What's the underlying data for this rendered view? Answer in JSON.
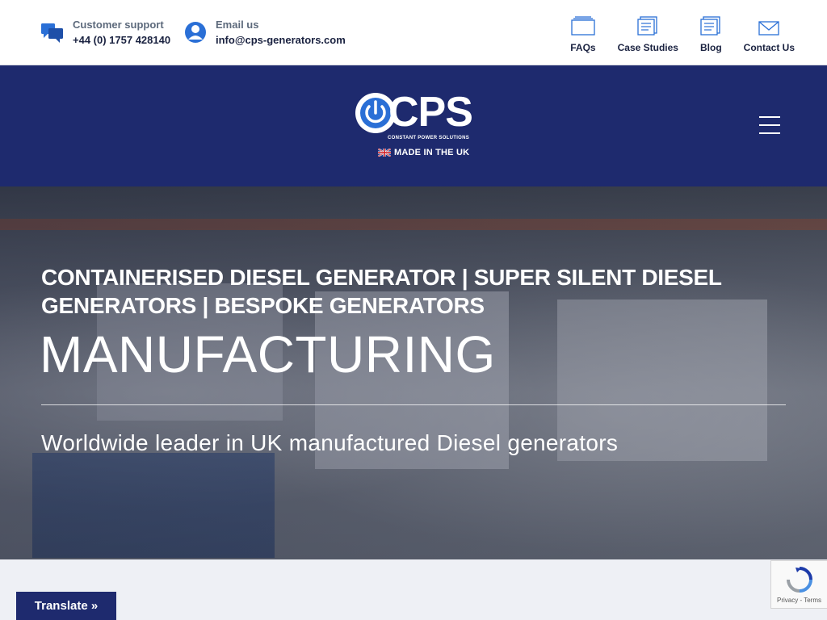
{
  "topbar": {
    "support": {
      "label": "Customer support",
      "value": "+44 (0) 1757 428140",
      "icon": "chat-bubbles-icon"
    },
    "email": {
      "label": "Email us",
      "value": "info@cps-generators.com",
      "icon": "user-icon"
    },
    "nav": [
      {
        "label": "FAQs",
        "icon": "folder-icon"
      },
      {
        "label": "Case Studies",
        "icon": "document-icon"
      },
      {
        "label": "Blog",
        "icon": "document-icon"
      },
      {
        "label": "Contact Us",
        "icon": "envelope-icon"
      }
    ]
  },
  "header": {
    "logo": {
      "letters": "CPS",
      "subtitle": "CONSTANT POWER SOLUTIONS",
      "made_in": "MADE IN THE UK"
    },
    "menu_icon": "hamburger-icon"
  },
  "hero": {
    "subtitle": "CONTAINERISED DIESEL GENERATOR | SUPER SILENT DIESEL GENERATORS | BESPOKE GENERATORS",
    "title": "MANUFACTURING",
    "tagline": "Worldwide leader in UK manufactured Diesel generators"
  },
  "widgets": {
    "translate_label": "Translate »",
    "recaptcha_text": "Privacy - Terms"
  },
  "colors": {
    "brand_navy": "#1e2a6e",
    "accent_blue": "#2a6fd6",
    "text_dark": "#1a2240"
  }
}
